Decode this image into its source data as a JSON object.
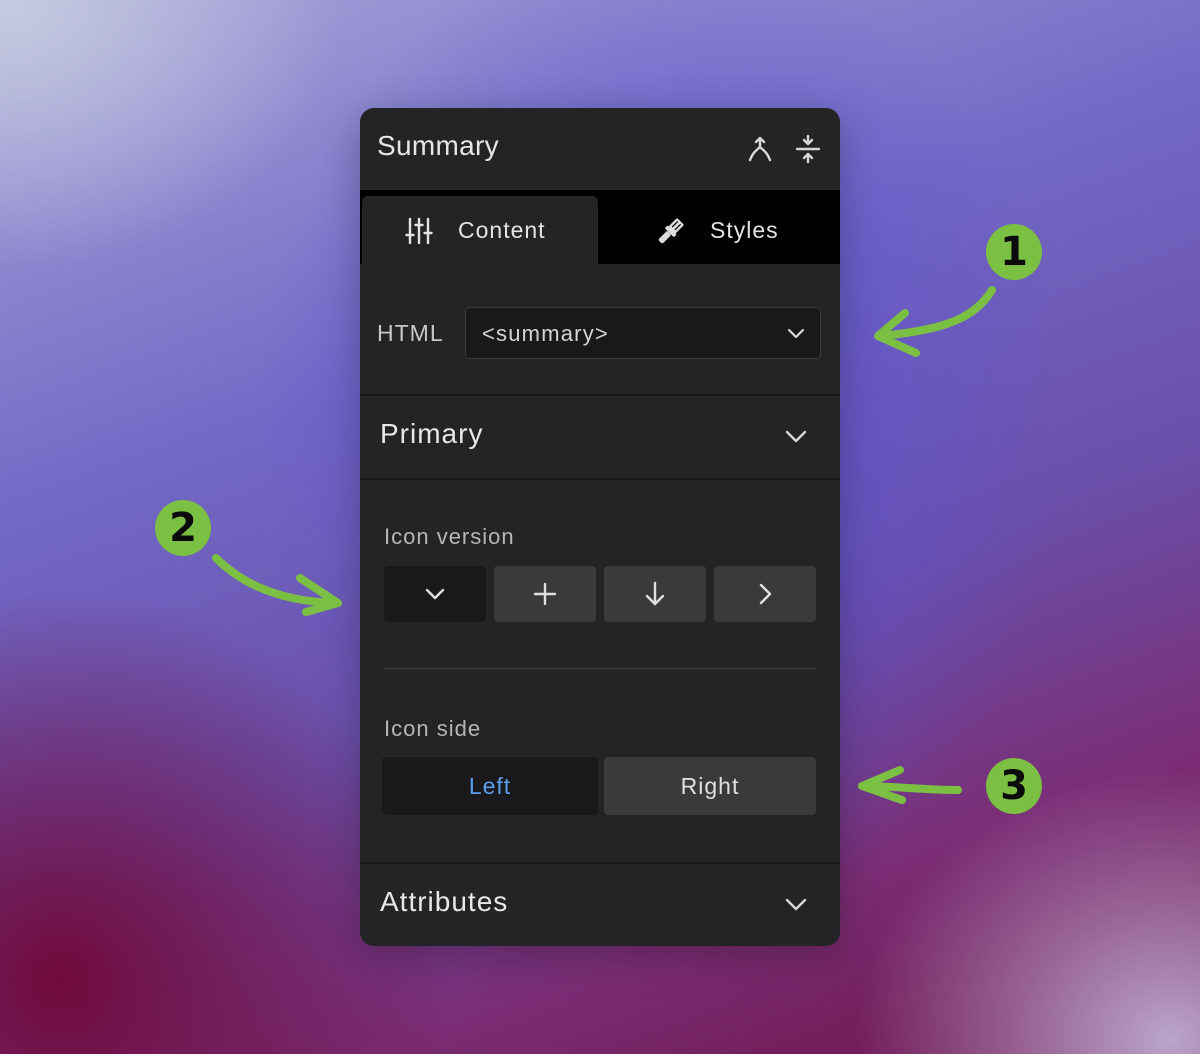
{
  "panel": {
    "title": "Summary",
    "header_icons": [
      "merge-icon",
      "collapse-vertical-icon"
    ]
  },
  "tabs": [
    {
      "label": "Content",
      "icon": "sliders-icon",
      "active": true
    },
    {
      "label": "Styles",
      "icon": "paintbrush-icon",
      "active": false
    }
  ],
  "html_field": {
    "label": "HTML",
    "value": "<summary>"
  },
  "sections": {
    "primary": "Primary",
    "attributes": "Attributes"
  },
  "icon_version": {
    "label": "Icon version",
    "options": [
      "chevron-down-icon",
      "plus-icon",
      "arrow-down-icon",
      "chevron-right-icon"
    ],
    "selected_index": 0
  },
  "icon_side": {
    "label": "Icon side",
    "options": [
      "Left",
      "Right"
    ],
    "selected": "Left"
  },
  "callouts": [
    "1",
    "2",
    "3"
  ],
  "colors": {
    "panel_bg": "#242426",
    "accent_blue": "#5b9eec",
    "callout_green": "#7bc043"
  }
}
